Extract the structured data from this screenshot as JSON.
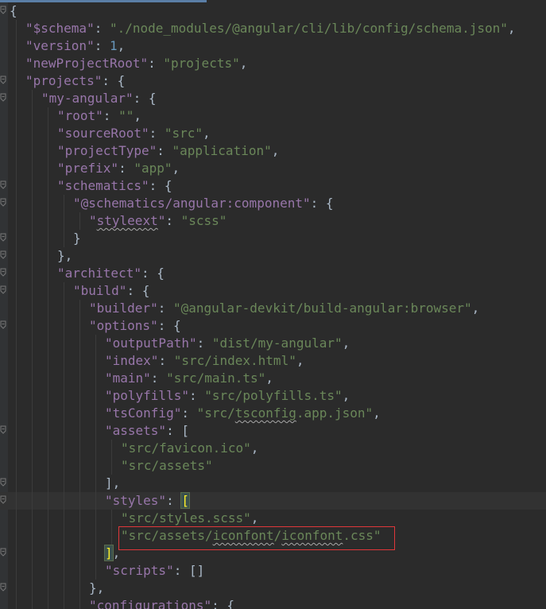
{
  "editor": {
    "colors": {
      "background": "#2b2b2b",
      "key": "#9876aa",
      "string": "#6a8759",
      "number": "#6897bb",
      "punctuation": "#a9b7c6",
      "highlight_box": "#e0373a",
      "bracket_match": "#ffef28"
    },
    "fold_icon": "fold-arrow-icon",
    "lines": [
      {
        "segs": [
          {
            "t": "{",
            "c": "p"
          }
        ]
      },
      {
        "segs": [
          {
            "t": "\"$schema\"",
            "c": "k"
          },
          {
            "t": ": ",
            "c": "p"
          },
          {
            "t": "\"./node_modules/@angular/cli/lib/config/schema.json\"",
            "c": "s"
          },
          {
            "t": ",",
            "c": "p"
          }
        ]
      },
      {
        "segs": [
          {
            "t": "\"version\"",
            "c": "k"
          },
          {
            "t": ": ",
            "c": "p"
          },
          {
            "t": "1",
            "c": "n"
          },
          {
            "t": ",",
            "c": "p"
          }
        ]
      },
      {
        "segs": [
          {
            "t": "\"newProjectRoot\"",
            "c": "k"
          },
          {
            "t": ": ",
            "c": "p"
          },
          {
            "t": "\"projects\"",
            "c": "s"
          },
          {
            "t": ",",
            "c": "p"
          }
        ]
      },
      {
        "segs": [
          {
            "t": "\"projects\"",
            "c": "k"
          },
          {
            "t": ": {",
            "c": "p"
          }
        ]
      },
      {
        "segs": [
          {
            "t": "\"my-angular\"",
            "c": "k"
          },
          {
            "t": ": {",
            "c": "p"
          }
        ]
      },
      {
        "segs": [
          {
            "t": "\"root\"",
            "c": "k"
          },
          {
            "t": ": ",
            "c": "p"
          },
          {
            "t": "\"\"",
            "c": "s"
          },
          {
            "t": ",",
            "c": "p"
          }
        ]
      },
      {
        "segs": [
          {
            "t": "\"sourceRoot\"",
            "c": "k"
          },
          {
            "t": ": ",
            "c": "p"
          },
          {
            "t": "\"src\"",
            "c": "s"
          },
          {
            "t": ",",
            "c": "p"
          }
        ]
      },
      {
        "segs": [
          {
            "t": "\"projectType\"",
            "c": "k"
          },
          {
            "t": ": ",
            "c": "p"
          },
          {
            "t": "\"application\"",
            "c": "s"
          },
          {
            "t": ",",
            "c": "p"
          }
        ]
      },
      {
        "segs": [
          {
            "t": "\"prefix\"",
            "c": "k"
          },
          {
            "t": ": ",
            "c": "p"
          },
          {
            "t": "\"app\"",
            "c": "s"
          },
          {
            "t": ",",
            "c": "p"
          }
        ]
      },
      {
        "segs": [
          {
            "t": "\"schematics\"",
            "c": "k"
          },
          {
            "t": ": {",
            "c": "p"
          }
        ]
      },
      {
        "segs": [
          {
            "t": "\"@schematics/angular:component\"",
            "c": "k"
          },
          {
            "t": ": {",
            "c": "p"
          }
        ]
      },
      {
        "segs": [
          {
            "t": "\"",
            "c": "k"
          },
          {
            "t": "styleext",
            "c": "k u"
          },
          {
            "t": "\"",
            "c": "k"
          },
          {
            "t": ": ",
            "c": "p"
          },
          {
            "t": "\"scss\"",
            "c": "s"
          }
        ]
      },
      {
        "segs": [
          {
            "t": "}",
            "c": "p"
          }
        ]
      },
      {
        "segs": [
          {
            "t": "},",
            "c": "p"
          }
        ]
      },
      {
        "segs": [
          {
            "t": "\"architect\"",
            "c": "k"
          },
          {
            "t": ": {",
            "c": "p"
          }
        ]
      },
      {
        "segs": [
          {
            "t": "\"build\"",
            "c": "k"
          },
          {
            "t": ": {",
            "c": "p"
          }
        ]
      },
      {
        "segs": [
          {
            "t": "\"builder\"",
            "c": "k"
          },
          {
            "t": ": ",
            "c": "p"
          },
          {
            "t": "\"@angular-devkit/build-angular:browser\"",
            "c": "s"
          },
          {
            "t": ",",
            "c": "p"
          }
        ]
      },
      {
        "segs": [
          {
            "t": "\"options\"",
            "c": "k"
          },
          {
            "t": ": {",
            "c": "p"
          }
        ]
      },
      {
        "segs": [
          {
            "t": "\"outputPath\"",
            "c": "k"
          },
          {
            "t": ": ",
            "c": "p"
          },
          {
            "t": "\"dist/my-angular\"",
            "c": "s"
          },
          {
            "t": ",",
            "c": "p"
          }
        ]
      },
      {
        "segs": [
          {
            "t": "\"index\"",
            "c": "k"
          },
          {
            "t": ": ",
            "c": "p"
          },
          {
            "t": "\"src/index.html\"",
            "c": "s"
          },
          {
            "t": ",",
            "c": "p"
          }
        ]
      },
      {
        "segs": [
          {
            "t": "\"main\"",
            "c": "k"
          },
          {
            "t": ": ",
            "c": "p"
          },
          {
            "t": "\"src/main.ts\"",
            "c": "s"
          },
          {
            "t": ",",
            "c": "p"
          }
        ]
      },
      {
        "segs": [
          {
            "t": "\"polyfills\"",
            "c": "k"
          },
          {
            "t": ": ",
            "c": "p"
          },
          {
            "t": "\"src/polyfills.ts\"",
            "c": "s"
          },
          {
            "t": ",",
            "c": "p"
          }
        ]
      },
      {
        "segs": [
          {
            "t": "\"tsConfig\"",
            "c": "k"
          },
          {
            "t": ": ",
            "c": "p"
          },
          {
            "t": "\"src/",
            "c": "s"
          },
          {
            "t": "tsconfig",
            "c": "s u"
          },
          {
            "t": ".app.json\"",
            "c": "s"
          },
          {
            "t": ",",
            "c": "p"
          }
        ]
      },
      {
        "segs": [
          {
            "t": "\"assets\"",
            "c": "k"
          },
          {
            "t": ": [",
            "c": "p"
          }
        ]
      },
      {
        "segs": [
          {
            "t": "\"src/favicon.ico\"",
            "c": "s"
          },
          {
            "t": ",",
            "c": "p"
          }
        ]
      },
      {
        "segs": [
          {
            "t": "\"src/assets\"",
            "c": "s"
          }
        ]
      },
      {
        "segs": [
          {
            "t": "],",
            "c": "p"
          }
        ]
      },
      {
        "segs": [
          {
            "t": "\"styles\"",
            "c": "k"
          },
          {
            "t": ": ",
            "c": "p"
          },
          {
            "t": "[",
            "c": "bm"
          }
        ]
      },
      {
        "segs": [
          {
            "t": "\"src/styles.scss\"",
            "c": "s"
          },
          {
            "t": ",",
            "c": "p"
          }
        ]
      },
      {
        "segs": [
          {
            "t": "\"src/assets/",
            "c": "s"
          },
          {
            "t": "iconfont",
            "c": "s u"
          },
          {
            "t": "/",
            "c": "s"
          },
          {
            "t": "iconfont",
            "c": "s u"
          },
          {
            "t": ".css\"",
            "c": "s"
          }
        ]
      },
      {
        "segs": [
          {
            "t": "]",
            "c": "bm"
          },
          {
            "t": ",",
            "c": "p"
          }
        ]
      },
      {
        "segs": [
          {
            "t": "\"scripts\"",
            "c": "k"
          },
          {
            "t": ": []",
            "c": "p"
          }
        ]
      },
      {
        "segs": [
          {
            "t": "},",
            "c": "p"
          }
        ]
      },
      {
        "segs": [
          {
            "t": "\"configurations\"",
            "c": "k"
          },
          {
            "t": ": {",
            "c": "p"
          }
        ]
      }
    ]
  }
}
